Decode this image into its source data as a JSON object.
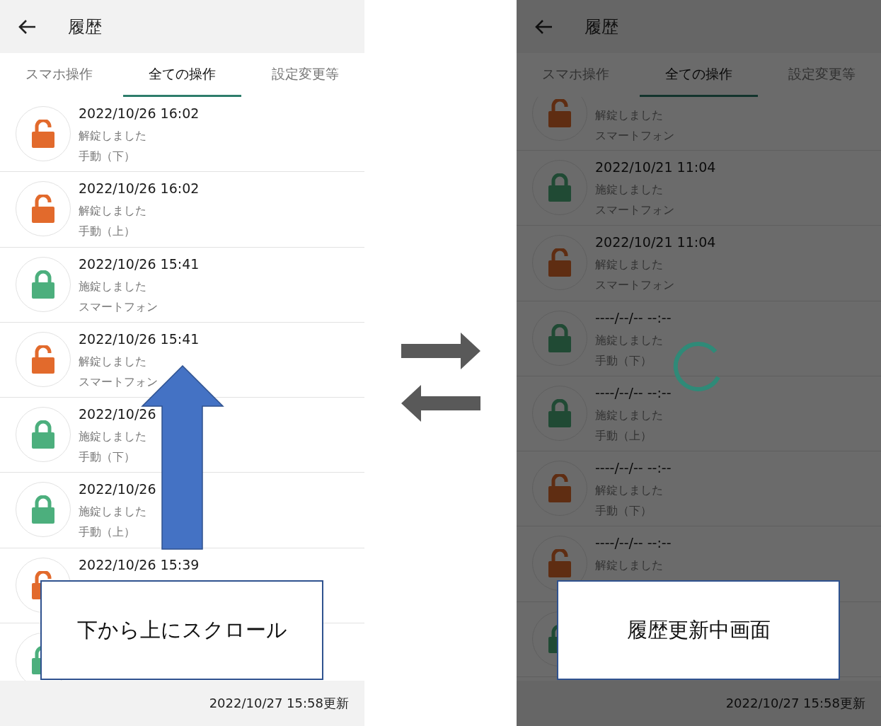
{
  "screens": [
    {
      "title": "履歴",
      "dimmed": false,
      "loading": false,
      "scroll_hint": true,
      "tabs": [
        {
          "label": "スマホ操作",
          "selected": false
        },
        {
          "label": "全ての操作",
          "selected": true
        },
        {
          "label": "設定変更等",
          "selected": false
        }
      ],
      "rows": [
        {
          "kind": "unlocked",
          "datetime": "2022/10/26 16:02",
          "action": "解錠しました",
          "source": "手動（下）"
        },
        {
          "kind": "unlocked",
          "datetime": "2022/10/26 16:02",
          "action": "解錠しました",
          "source": "手動（上）"
        },
        {
          "kind": "locked",
          "datetime": "2022/10/26 15:41",
          "action": "施錠しました",
          "source": "スマートフォン"
        },
        {
          "kind": "unlocked",
          "datetime": "2022/10/26 15:41",
          "action": "解錠しました",
          "source": "スマートフォン"
        },
        {
          "kind": "locked",
          "datetime": "2022/10/26",
          "action": "施錠しました",
          "source": "手動（下）"
        },
        {
          "kind": "locked",
          "datetime": "2022/10/26",
          "action": "施錠しました",
          "source": "手動（上）"
        },
        {
          "kind": "unlocked",
          "datetime": "2022/10/26 15:39"
        },
        {
          "kind": "locked"
        }
      ],
      "footer": "2022/10/27 15:58更新",
      "callout": "下から上にスクロール"
    },
    {
      "title": "履歴",
      "dimmed": true,
      "loading": true,
      "scroll_hint": false,
      "tabs": [
        {
          "label": "スマホ操作",
          "selected": false
        },
        {
          "label": "全ての操作",
          "selected": true
        },
        {
          "label": "設定変更等",
          "selected": false
        }
      ],
      "rows": [
        {
          "kind": "unlocked",
          "action": "解錠しました",
          "source": "スマートフォン"
        },
        {
          "kind": "locked",
          "datetime": "2022/10/21 11:04",
          "action": "施錠しました",
          "source": "スマートフォン"
        },
        {
          "kind": "unlocked",
          "datetime": "2022/10/21 11:04",
          "action": "解錠しました",
          "source": "スマートフォン"
        },
        {
          "kind": "locked",
          "datetime": "----/--/-- --:--",
          "action": "施錠しました",
          "source": "手動（下）"
        },
        {
          "kind": "locked",
          "datetime": "----/--/-- --:--",
          "action": "施錠しました",
          "source": "手動（上）"
        },
        {
          "kind": "unlocked",
          "datetime": "----/--/-- --:--",
          "action": "解錠しました",
          "source": "手動（下）"
        },
        {
          "kind": "unlocked",
          "datetime": "----/--/-- --:--",
          "action": "解錠しました"
        },
        {
          "kind": "locked"
        }
      ],
      "footer": "2022/10/27 15:58更新",
      "callout": "履歴更新中画面"
    }
  ]
}
